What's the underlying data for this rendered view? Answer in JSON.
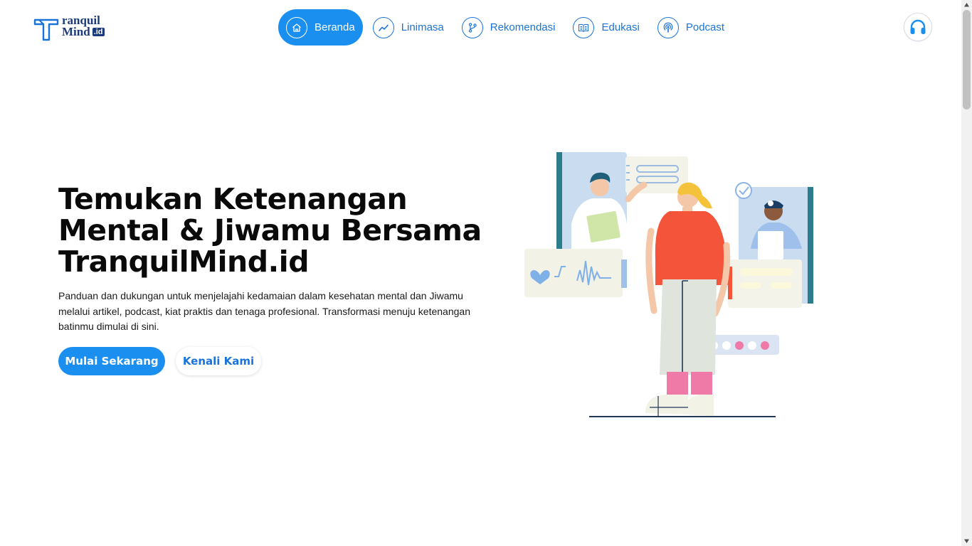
{
  "brand": {
    "line1": "ranquil",
    "line2": "Mind",
    "badge": ".id"
  },
  "nav": [
    {
      "label": "Beranda",
      "icon": "home-icon",
      "active": true
    },
    {
      "label": "Linimasa",
      "icon": "trend-icon",
      "active": false
    },
    {
      "label": "Rekomendasi",
      "icon": "branch-icon",
      "active": false
    },
    {
      "label": "Edukasi",
      "icon": "book-icon",
      "active": false
    },
    {
      "label": "Podcast",
      "icon": "podcast-icon",
      "active": false
    }
  ],
  "hero": {
    "title_l1": "Temukan Ketenangan",
    "title_l2": "Mental & Jiwamu Bersama",
    "title_l3": "TranquilMind.id",
    "description": "Panduan dan dukungan untuk menjelajahi kedamaian dalam kesehatan mental dan Jiwamu melalui artikel, podcast, kiat praktis dan tenaga profesional. Transformasi menuju ketenangan batinmu dimulai di sini.",
    "primary_button": "Mulai Sekarang",
    "secondary_button": "Kenali Kami"
  },
  "colors": {
    "accent": "#1a8ff0",
    "link": "#1a73d9",
    "brand": "#1b3a7c",
    "shirt": "#f4553a"
  }
}
